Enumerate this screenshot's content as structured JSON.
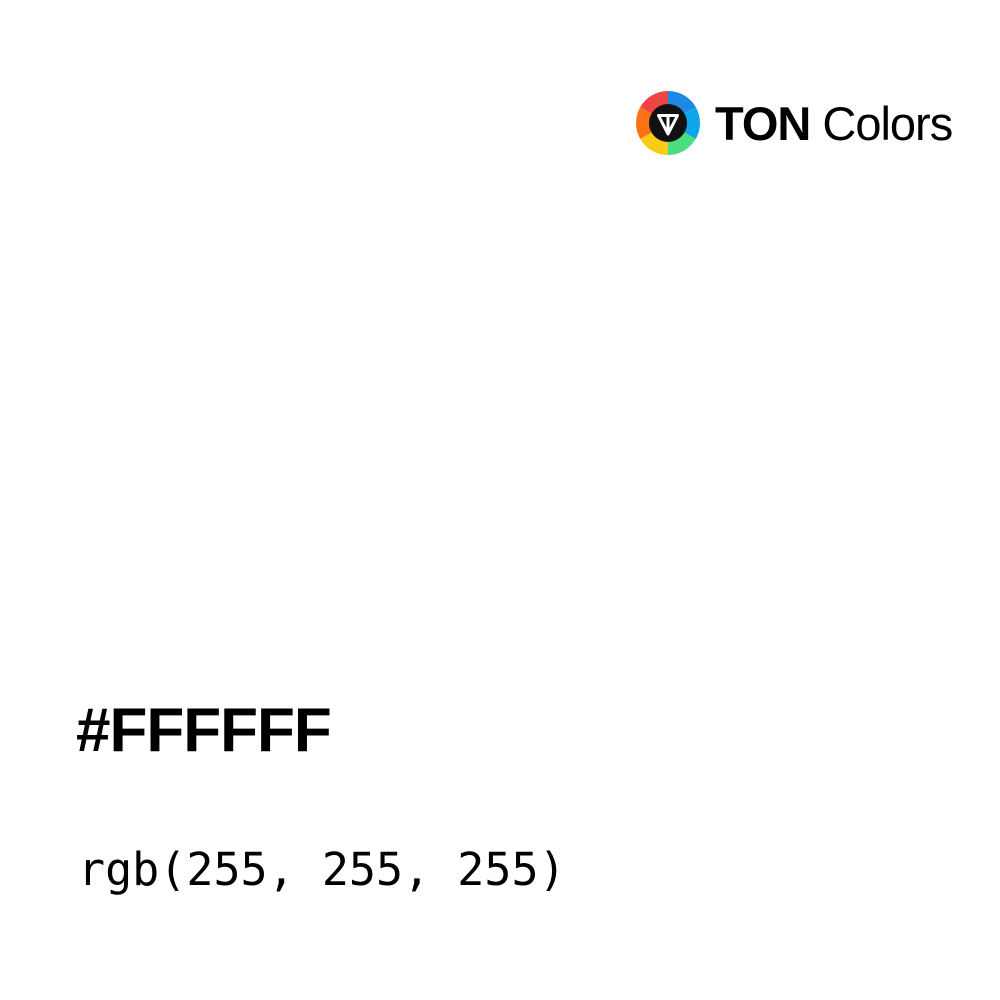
{
  "brand": {
    "name_strong": "TON",
    "name_light": "Colors",
    "icon": "ton-colors-logo-icon"
  },
  "color": {
    "hex": "#FFFFFF",
    "rgb": "rgb(255, 255, 255)"
  },
  "colors": {
    "background": "#FFFFFF",
    "text": "#000000",
    "logo_red": "#EF4444",
    "logo_blue": "#1E88E5",
    "logo_green": "#4ADE80",
    "logo_yellow": "#FACC15",
    "logo_orange": "#F97316",
    "logo_center": "#111111"
  }
}
